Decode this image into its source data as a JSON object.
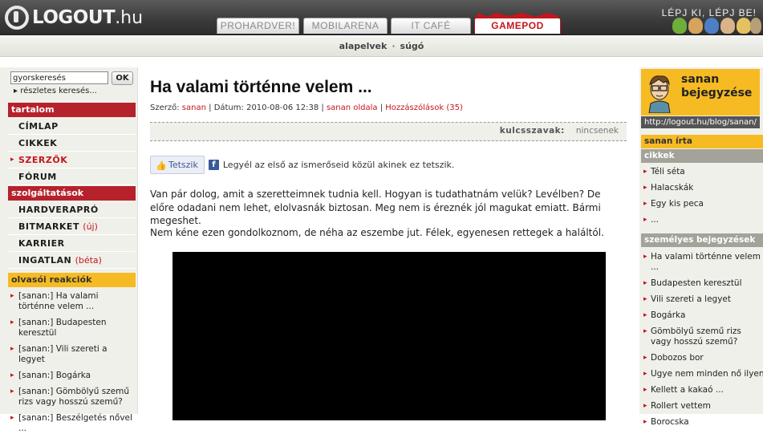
{
  "header": {
    "logo_name": "LOGOUT",
    "logo_tld": ".hu",
    "tabs": [
      "PROHARDVER!",
      "MOBILARENA",
      "IT CAFÉ",
      "GAMEPOD"
    ],
    "tagline": "LÉPJ KI, LÉPJ BE!"
  },
  "subnav": {
    "items": [
      "alapelvek",
      "súgó"
    ],
    "separator": "·"
  },
  "left": {
    "search_value": "gyorskeresés",
    "ok_label": "OK",
    "detail_link": "részletes keresés...",
    "content_heading": "tartalom",
    "content_items": [
      "CÍMLAP",
      "CIKKEK",
      "SZERZŐK",
      "FÓRUM"
    ],
    "services_heading": "szolgáltatások",
    "services_items": [
      "HARDVERAPRÓ",
      "BITMARKET",
      "KARRIER",
      "INGATLAN"
    ],
    "services_tags": {
      "bitmarket": "(új)",
      "ingatlan": "(béta)"
    },
    "reactions_heading": "olvasói reakciók",
    "reactions": [
      "[sanan:] Ha valami történne velem ...",
      "[sanan:] Budapesten keresztül",
      "[sanan:] Vili szereti a legyet",
      "[sanan:] Bogárka",
      "[sanan:] Gömbölyű szemű rizs vagy hosszú szemű?",
      "[sanan:] Beszélgetés nővel ..."
    ]
  },
  "article": {
    "title": "Ha valami történne velem ...",
    "author_label": "Szerző:",
    "author": "sanan",
    "date_label": "Dátum:",
    "date": "2010-08-06 12:38",
    "page_link": "sanan oldala",
    "comments_link": "Hozzászólások (35)",
    "keywords_label": "kulcsszavak:",
    "keywords_value": "nincsenek",
    "like_label": "Tetszik",
    "fb_text": "Legyél az első az ismerőseid közül akinek ez tetszik.",
    "para1": "Van pár dolog, amit a szeretteimnek tudnia kell. Hogyan is tudathatnám velük? Levélben? De előre odadani nem lehet, elolvasnák biztosan. Meg nem is éreznék jól magukat emiatt. Bármi megeshet.",
    "para2": "Nem kéne ezen gondolkoznom, de néha az eszembe jut. Félek, egyenesen rettegek a haláltól."
  },
  "right": {
    "title_line1": "sanan",
    "title_line2": "bejegyzése",
    "blog_url": "http://logout.hu/blog/sanan/",
    "wrote_heading": "sanan írta",
    "articles_heading": "cikkek",
    "articles": [
      "Téli séta",
      "Halacskák",
      "Egy kis peca",
      "..."
    ],
    "personal_heading": "személyes bejegyzések",
    "personal": [
      "Ha valami történne velem ...",
      "Budapesten keresztül",
      "Vili szereti a legyet",
      "Bogárka",
      "Gömbölyű szemű rizs vagy hosszú szemű?",
      "Dobozos bor",
      "Ugye nem minden nő ilyen...",
      "Kellett a kakaó ...",
      "Rollert vettem",
      "Borocska"
    ]
  },
  "colors": {
    "brand_red": "#c4161c",
    "nav_yellow": "#f6bb23",
    "header_dark": "#3a3a3a"
  }
}
